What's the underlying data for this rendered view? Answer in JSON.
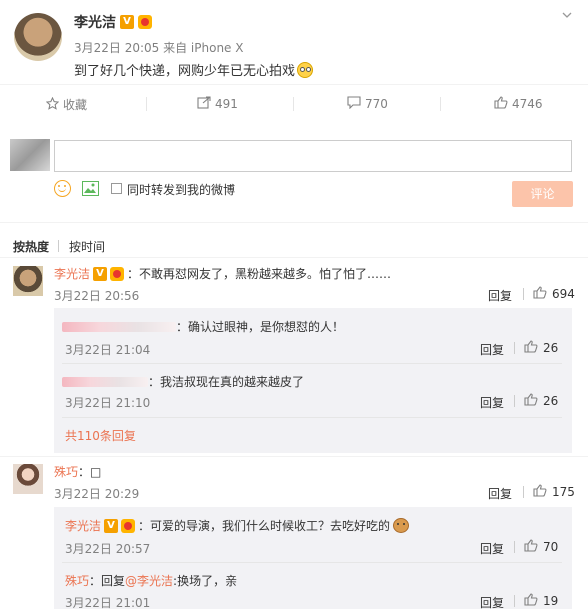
{
  "post": {
    "author": "李光洁",
    "meta": "3月22日 20:05 来自 iPhone X",
    "text": "到了好几个快递，网购少年已无心拍戏",
    "emoji": "😳"
  },
  "actions": {
    "favorite": "收藏",
    "repost": "491",
    "comment": "770",
    "like": "4746"
  },
  "composer": {
    "checkbox_label": "同时转发到我的微博",
    "publish": "评论"
  },
  "sort": {
    "hot": "按热度",
    "time": "按时间"
  },
  "comments": [
    {
      "user": "李光洁",
      "text": "：不敢再怼网友了，黑粉越来越多。怕了怕了……",
      "time": "3月22日 20:56",
      "reply": "回复",
      "likes": "694",
      "subs": [
        {
          "user_blur": true,
          "text": "：确认过眼神，是你想怼的人！",
          "time": "3月22日 21:04",
          "reply": "回复",
          "likes": "26"
        },
        {
          "user_blur": true,
          "text": "：我洁叔现在真的越来越皮了",
          "time": "3月22日 21:10",
          "reply": "回复",
          "likes": "26"
        }
      ],
      "more": "共110条回复"
    },
    {
      "user": "殊巧",
      "text": "：□",
      "time": "3月22日 20:29",
      "reply": "回复",
      "likes": "175",
      "subs": [
        {
          "user": "李光洁",
          "text": "：可爱的导演，我们什么时候收工？去吃好吃的",
          "time": "3月22日 20:57",
          "reply": "回复",
          "likes": "70"
        },
        {
          "user": "殊巧",
          "text": "：回复",
          "mention": "@李光洁",
          "text2": ":换场了，亲",
          "time": "3月22日 21:01",
          "reply": "回复",
          "likes": "19"
        }
      ]
    }
  ]
}
